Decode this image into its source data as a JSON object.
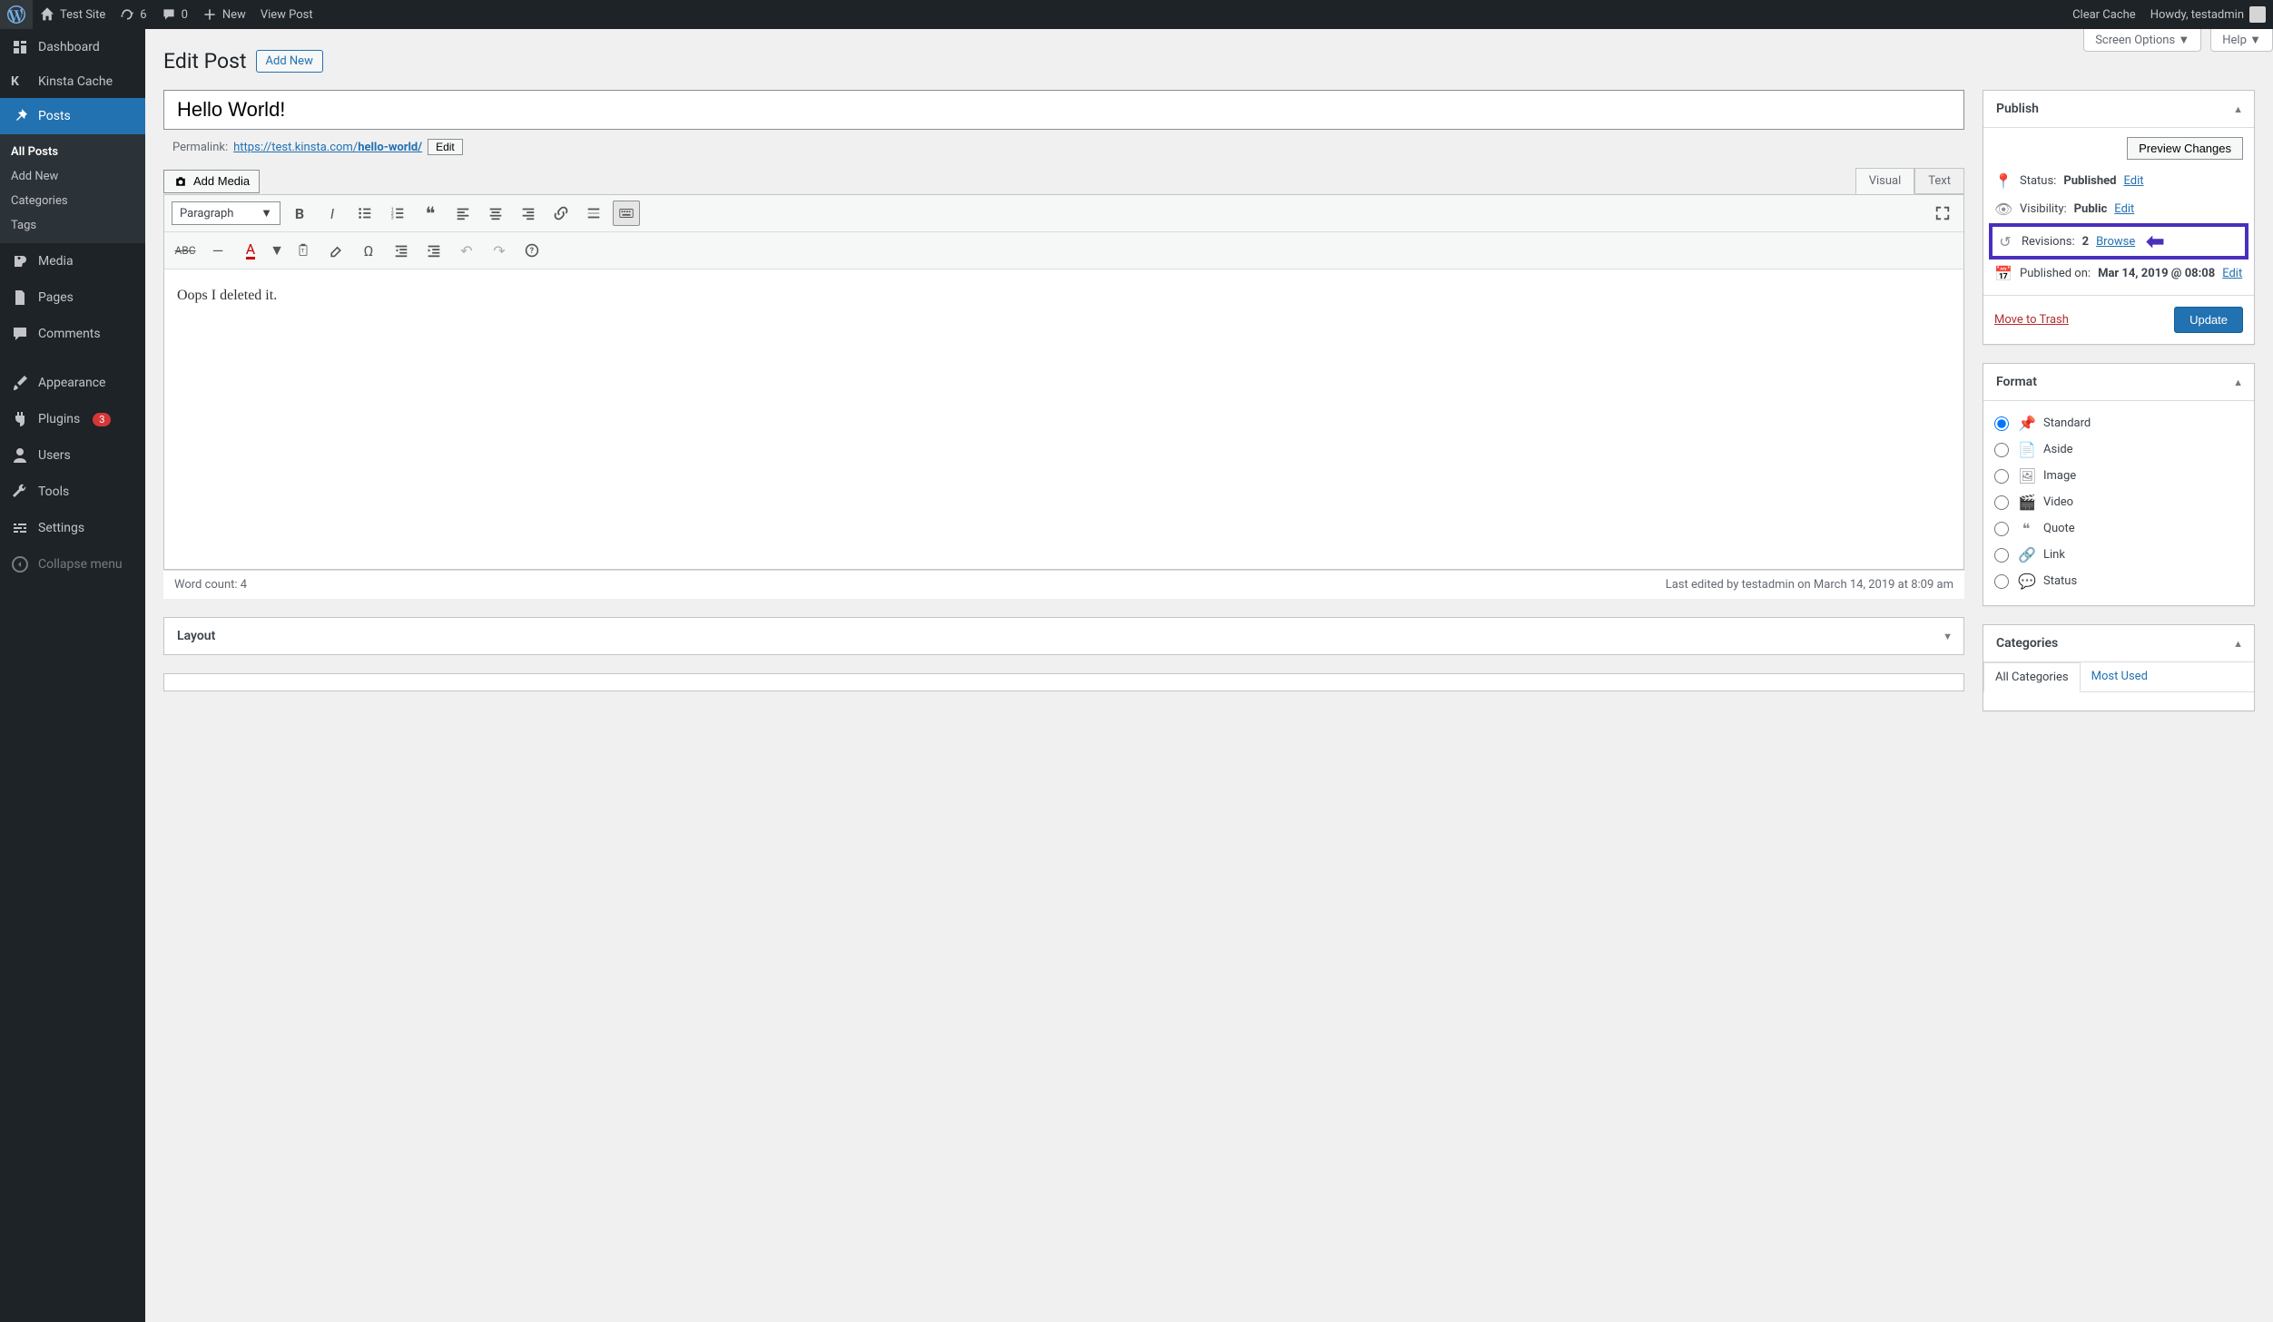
{
  "adminbar": {
    "site_name": "Test Site",
    "updates": "6",
    "comments": "0",
    "new": "New",
    "view_post": "View Post",
    "clear_cache": "Clear Cache",
    "howdy": "Howdy, testadmin"
  },
  "sidebar": {
    "dashboard": "Dashboard",
    "kinsta": "Kinsta Cache",
    "posts": "Posts",
    "posts_sub": {
      "all": "All Posts",
      "add": "Add New",
      "cat": "Categories",
      "tags": "Tags"
    },
    "media": "Media",
    "pages": "Pages",
    "comments": "Comments",
    "appearance": "Appearance",
    "plugins": "Plugins",
    "plugins_badge": "3",
    "users": "Users",
    "tools": "Tools",
    "settings": "Settings",
    "collapse": "Collapse menu"
  },
  "screen_meta": {
    "screen_options": "Screen Options",
    "help": "Help"
  },
  "heading": {
    "title": "Edit Post",
    "add_new": "Add New"
  },
  "post": {
    "title": "Hello World!",
    "permalink_label": "Permalink:",
    "permalink_base": "https://test.kinsta.com/",
    "permalink_slug": "hello-world/",
    "permalink_edit": "Edit",
    "add_media": "Add Media",
    "tab_visual": "Visual",
    "tab_text": "Text",
    "format_dropdown": "Paragraph",
    "content": "Oops I deleted it.",
    "word_count": "Word count: 4",
    "last_edited": "Last edited by testadmin on March 14, 2019 at 8:09 am"
  },
  "publish": {
    "title": "Publish",
    "preview": "Preview Changes",
    "status_label": "Status:",
    "status_value": "Published",
    "status_edit": "Edit",
    "visibility_label": "Visibility:",
    "visibility_value": "Public",
    "visibility_edit": "Edit",
    "revisions_label": "Revisions:",
    "revisions_count": "2",
    "revisions_browse": "Browse",
    "published_label": "Published on:",
    "published_value": "Mar 14, 2019 @ 08:08",
    "published_edit": "Edit",
    "trash": "Move to Trash",
    "update": "Update"
  },
  "format": {
    "title": "Format",
    "standard": "Standard",
    "aside": "Aside",
    "image": "Image",
    "video": "Video",
    "quote": "Quote",
    "link": "Link",
    "status": "Status"
  },
  "categories": {
    "title": "Categories",
    "tab_all": "All Categories",
    "tab_most": "Most Used"
  },
  "layout": {
    "title": "Layout"
  }
}
